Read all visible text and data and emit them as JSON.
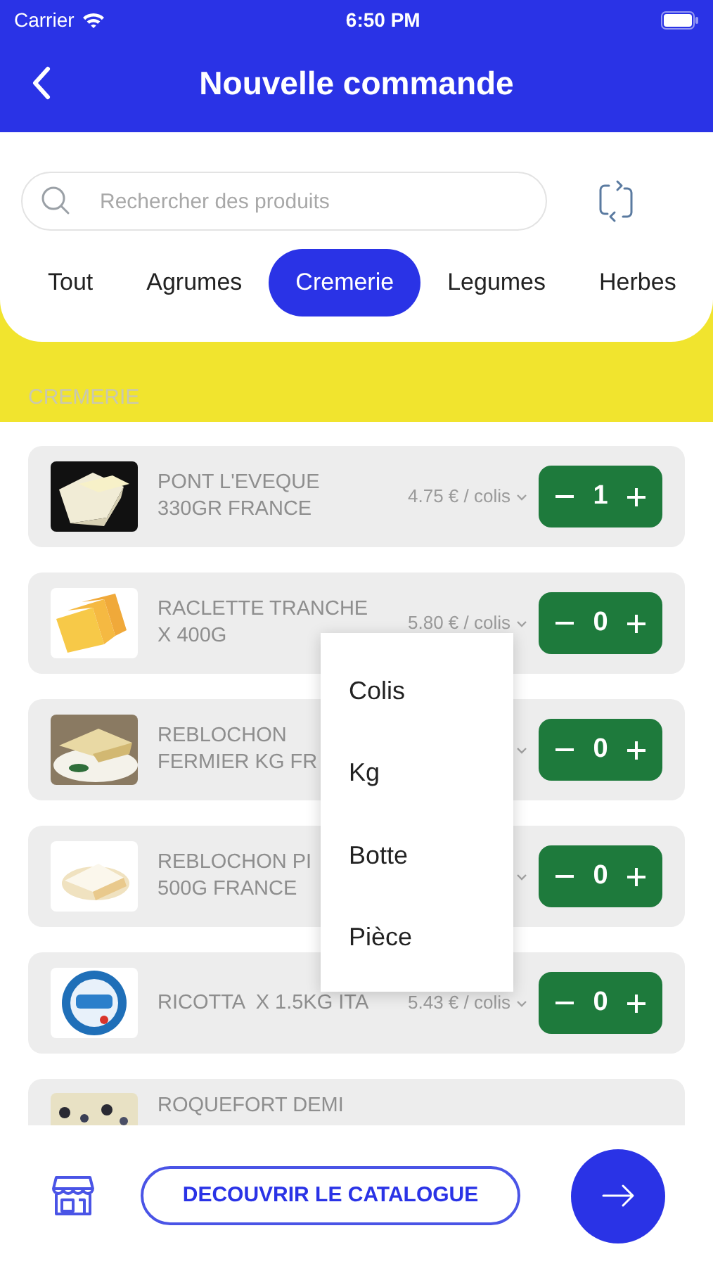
{
  "status_bar": {
    "carrier": "Carrier",
    "time": "6:50 PM"
  },
  "header": {
    "title": "Nouvelle commande"
  },
  "search": {
    "placeholder": "Rechercher des produits"
  },
  "tabs": [
    {
      "label": "Tout",
      "selected": false
    },
    {
      "label": "Agrumes",
      "selected": false
    },
    {
      "label": "Cremerie",
      "selected": true
    },
    {
      "label": "Legumes",
      "selected": false
    },
    {
      "label": "Herbes",
      "selected": false
    }
  ],
  "section_title": "CREMERIE",
  "products": [
    {
      "name": "PONT L'EVEQUE\n330GR FRANCE",
      "price": "4.75 € / colis",
      "quantity": "1"
    },
    {
      "name": "RACLETTE TRANCHE\nX 400G",
      "price": "5.80 € / colis",
      "quantity": "0"
    },
    {
      "name": "REBLOCHON\nFERMIER KG FR",
      "quantity": "0"
    },
    {
      "name": "REBLOCHON PI\n500G FRANCE",
      "quantity": "0"
    },
    {
      "name": "RICOTTA  X 1.5KG ITA",
      "price": "5.43 € / colis",
      "quantity": "0"
    },
    {
      "name": "ROQUEFORT DEMI"
    }
  ],
  "unit_menu": {
    "options": [
      "Colis",
      "Kg",
      "Botte",
      "Pièce"
    ]
  },
  "footer": {
    "catalogue_button": "DECOUVRIR LE CATALOGUE"
  }
}
